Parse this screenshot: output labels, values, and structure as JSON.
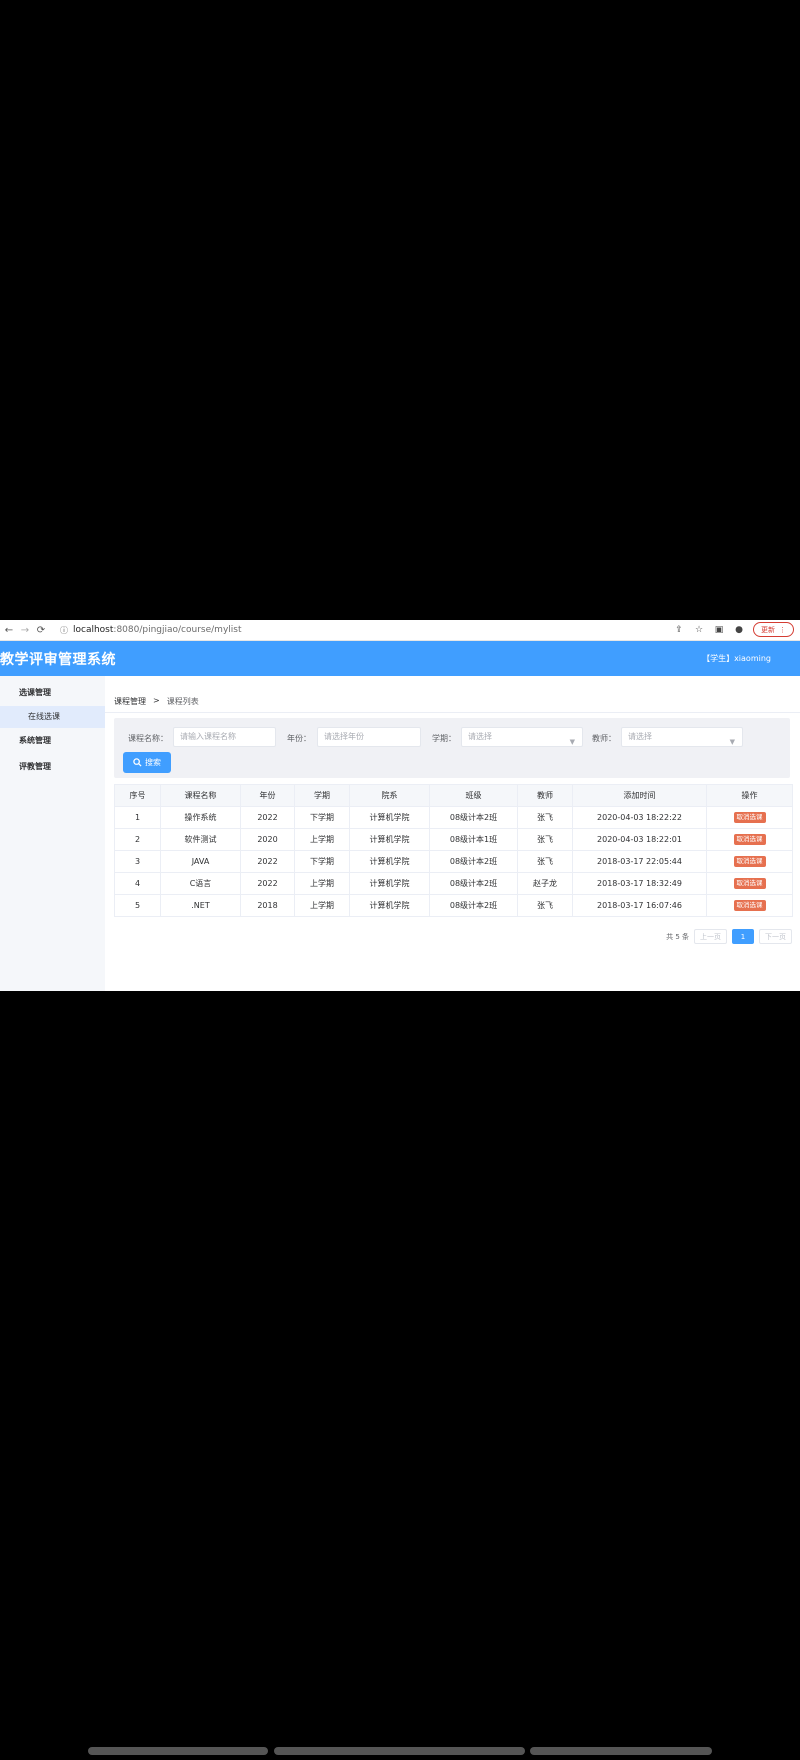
{
  "browser": {
    "url_host": "localhost",
    "url_path": ":8080/pingjiao/course/mylist",
    "update_label": "更新"
  },
  "app": {
    "title": "教学评审管理系统",
    "user_label": "【学生】xiaoming"
  },
  "sidebar": {
    "groups": [
      {
        "label": "选课管理",
        "items": [
          {
            "label": "在线选课"
          }
        ]
      },
      {
        "label": "系统管理"
      },
      {
        "label": "评教管理"
      }
    ]
  },
  "breadcrumb": {
    "root": "课程管理",
    "separator": ">",
    "current": "课程列表"
  },
  "filters": {
    "course_name": {
      "label": "课程名称：",
      "placeholder": "请输入课程名称"
    },
    "year": {
      "label": "年份：",
      "placeholder": "请选择年份"
    },
    "term": {
      "label": "学期：",
      "placeholder": "请选择"
    },
    "teacher": {
      "label": "教师：",
      "placeholder": "请选择"
    },
    "search_label": "搜索"
  },
  "table": {
    "headers": [
      "序号",
      "课程名称",
      "年份",
      "学期",
      "院系",
      "班级",
      "教师",
      "添加时间",
      "操作"
    ],
    "rows": [
      {
        "no": "1",
        "course": "操作系统",
        "year": "2022",
        "term": "下学期",
        "dept": "计算机学院",
        "class": "08级计本2班",
        "teacher": "张飞",
        "time": "2020-04-03 18:22:22",
        "action": "取消选课"
      },
      {
        "no": "2",
        "course": "软件测试",
        "year": "2020",
        "term": "上学期",
        "dept": "计算机学院",
        "class": "08级计本1班",
        "teacher": "张飞",
        "time": "2020-04-03 18:22:01",
        "action": "取消选课"
      },
      {
        "no": "3",
        "course": "JAVA",
        "year": "2022",
        "term": "下学期",
        "dept": "计算机学院",
        "class": "08级计本2班",
        "teacher": "张飞",
        "time": "2018-03-17 22:05:44",
        "action": "取消选课"
      },
      {
        "no": "4",
        "course": "C语言",
        "year": "2022",
        "term": "上学期",
        "dept": "计算机学院",
        "class": "08级计本2班",
        "teacher": "赵子龙",
        "time": "2018-03-17 18:32:49",
        "action": "取消选课"
      },
      {
        "no": "5",
        "course": ".NET",
        "year": "2018",
        "term": "上学期",
        "dept": "计算机学院",
        "class": "08级计本2班",
        "teacher": "张飞",
        "time": "2018-03-17 16:07:46",
        "action": "取消选课"
      }
    ]
  },
  "pagination": {
    "total_label": "共 5 条",
    "prev_label": "上一页",
    "current_page": "1",
    "next_label": "下一页"
  },
  "colors": {
    "primary": "#409eff",
    "danger_tag": "#e6704f"
  }
}
